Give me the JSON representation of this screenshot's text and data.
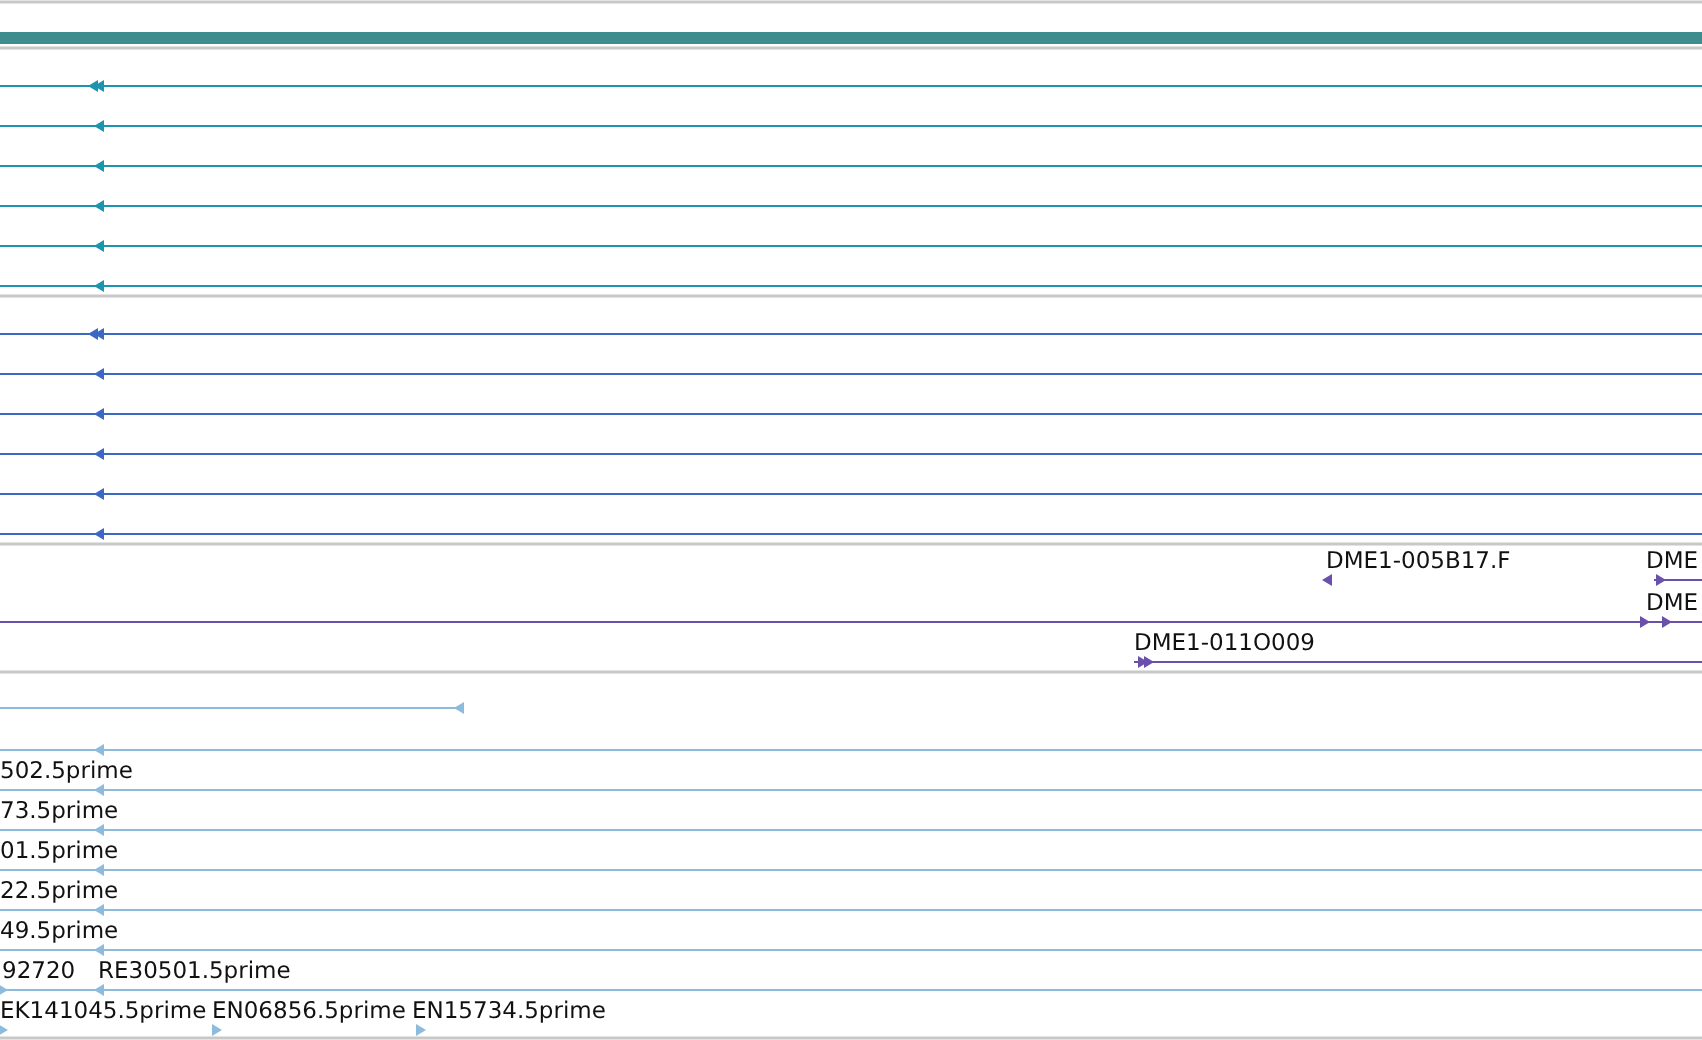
{
  "tracks": [
    {
      "color": "#1b95ad",
      "rows": [
        {
          "features": [
            {
              "kind": "double",
              "reverse": true
            }
          ]
        },
        {
          "features": [
            {
              "kind": "single",
              "reverse": true
            }
          ]
        },
        {
          "features": [
            {
              "kind": "single",
              "reverse": true
            }
          ]
        },
        {
          "features": [
            {
              "kind": "single",
              "reverse": true
            }
          ]
        },
        {
          "features": [
            {
              "kind": "single",
              "reverse": true
            }
          ]
        },
        {
          "features": [
            {
              "kind": "single",
              "reverse": true
            }
          ]
        }
      ]
    },
    {
      "color": "#3b68c2",
      "rows": [
        {
          "features": [
            {
              "kind": "double",
              "reverse": true
            }
          ]
        },
        {
          "features": [
            {
              "kind": "single",
              "reverse": true
            }
          ]
        },
        {
          "features": [
            {
              "kind": "single",
              "reverse": true
            }
          ]
        },
        {
          "features": [
            {
              "kind": "single",
              "reverse": true
            }
          ]
        },
        {
          "features": [
            {
              "kind": "single",
              "reverse": true
            }
          ]
        },
        {
          "features": [
            {
              "kind": "single",
              "reverse": true
            }
          ]
        }
      ]
    },
    {
      "color": "#6a50aa",
      "rows": [
        {
          "features": [
            {
              "kind": "single",
              "reverse": true,
              "label": "DME1-005B17.F"
            },
            {
              "kind": "single",
              "reverse": false,
              "label": "DME"
            }
          ]
        },
        {
          "features": [
            {
              "kind": "single",
              "reverse": false
            },
            {
              "kind": "single",
              "reverse": false,
              "label": "DME"
            }
          ]
        },
        {
          "features": [
            {
              "kind": "double",
              "reverse": false,
              "label": "DME1-011O009"
            }
          ]
        }
      ]
    },
    {
      "color": "#8dbbdc",
      "rows": [
        {
          "features": [
            {
              "kind": "single",
              "reverse": true
            }
          ]
        },
        {
          "features": [
            {
              "kind": "single",
              "reverse": true
            }
          ]
        },
        {
          "features": [
            {
              "kind": "single",
              "reverse": true,
              "label": "502.5prime"
            }
          ]
        },
        {
          "features": [
            {
              "kind": "single",
              "reverse": true,
              "label": "73.5prime"
            }
          ]
        },
        {
          "features": [
            {
              "kind": "single",
              "reverse": true,
              "label": "01.5prime"
            }
          ]
        },
        {
          "features": [
            {
              "kind": "single",
              "reverse": true,
              "label": "22.5prime"
            }
          ]
        },
        {
          "features": [
            {
              "kind": "single",
              "reverse": true,
              "label": "49.5prime"
            }
          ]
        },
        {
          "features": [
            {
              "kind": "single",
              "reverse": false,
              "label": "92720"
            },
            {
              "kind": "single",
              "reverse": true,
              "label": "RE30501.5prime"
            }
          ]
        },
        {
          "features": [
            {
              "kind": "single",
              "reverse": false,
              "label": "EK141045.5prime"
            },
            {
              "kind": "single",
              "reverse": false,
              "label": "EN06856.5prime"
            },
            {
              "kind": "single",
              "reverse": false,
              "label": "EN15734.5prime"
            }
          ]
        }
      ]
    }
  ]
}
